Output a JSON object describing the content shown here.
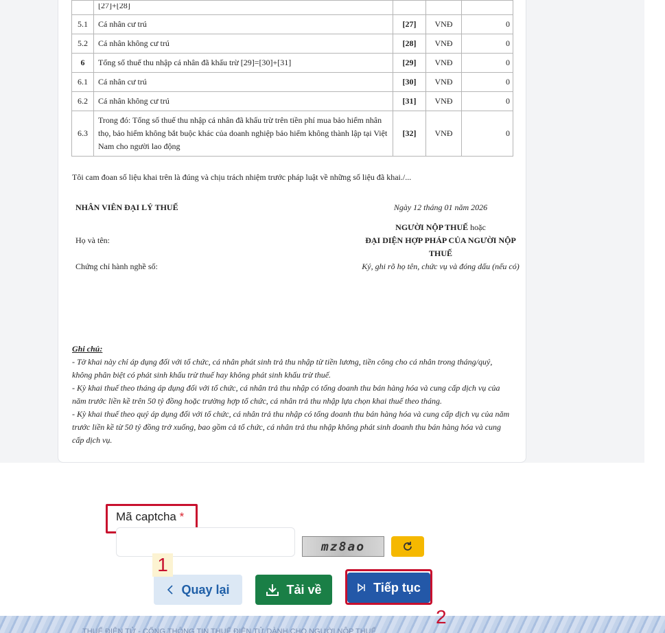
{
  "table": {
    "top_row": {
      "desc": "[27]+[28]"
    },
    "rows": [
      {
        "stt": "5.1",
        "desc": "Cá nhân cư trú",
        "code": "[27]",
        "unit": "VNĐ",
        "value": "0"
      },
      {
        "stt": "5.2",
        "desc": "Cá nhân không cư trú",
        "code": "[28]",
        "unit": "VNĐ",
        "value": "0"
      },
      {
        "stt": "6",
        "desc": "Tổng số thuế thu nhập cá nhân đã khấu trừ [29]=[30]+[31]",
        "code": "[29]",
        "unit": "VNĐ",
        "value": "0"
      },
      {
        "stt": "6.1",
        "desc": "Cá nhân cư trú",
        "code": "[30]",
        "unit": "VNĐ",
        "value": "0"
      },
      {
        "stt": "6.2",
        "desc": "Cá nhân không cư trú",
        "code": "[31]",
        "unit": "VNĐ",
        "value": "0"
      },
      {
        "stt": "6.3",
        "desc": "Trong đó: Tổng số thuế thu nhập cá nhân đã khấu trừ trên tiền phí mua bảo hiểm nhân thọ, bảo hiểm không bắt buộc khác của doanh nghiệp bảo hiểm không thành lập tại Việt Nam cho người lao động",
        "code": "[32]",
        "unit": "VNĐ",
        "value": "0"
      }
    ]
  },
  "commitment": "Tôi cam đoan số liệu khai trên là đúng và chịu trách nhiệm trước pháp luật về những số liệu đã khai./...",
  "signature": {
    "agent_title": "NHÂN VIÊN ĐẠI LÝ THUẾ",
    "name_label": "Họ và tên:",
    "cert_label": "Chứng chỉ hành nghề số:",
    "date": "Ngày 12 tháng 01 năm 2026",
    "taxpayer_line1": "NGƯỜI NỘP THUẾ",
    "taxpayer_or": "hoặc",
    "taxpayer_line2": "ĐẠI DIỆN HỢP PHÁP CỦA NGƯỜI NỘP THUẾ",
    "sign_note": "Ký, ghi rõ họ tên, chức vụ và đóng dấu (nếu có)"
  },
  "notes": {
    "title": "Ghi chú:",
    "items": [
      "- Tờ khai này chỉ áp dụng đối với tổ chức, cá nhân phát sinh trả thu nhập từ tiền lương, tiền công cho cá nhân trong tháng/quý, không phân biệt có phát sinh khấu trừ thuế hay không phát sinh khấu trừ thuế.",
      "- Kỳ khai thuế theo tháng áp dụng đối với tổ chức, cá nhân trả thu nhập có tổng doanh thu bán hàng hóa và cung cấp dịch vụ của năm trước liền kề trên 50 tỷ đồng hoặc trường hợp tổ chức, cá nhân trả thu nhập lựa chọn khai thuế theo tháng.",
      "- Kỳ khai thuế theo quý áp dụng đối với tổ chức, cá nhân trả thu nhập có tổng doanh thu bán hàng hóa và cung cấp dịch vụ của năm trước liền kề từ 50 tỷ đồng trở xuống, bao gồm cả tổ chức, cá nhân trả thu nhập không phát sinh doanh thu bán hàng hóa và cung cấp dịch vụ."
    ]
  },
  "form": {
    "captcha_label": "Mã captcha",
    "required_mark": "*",
    "captcha_value": "",
    "captcha_image_text": "mz8ao",
    "buttons": {
      "back": "Quay lại",
      "download": "Tải về",
      "next": "Tiếp tục"
    },
    "back_icon": "chevron-left-icon",
    "download_icon": "download-icon",
    "next_icon": "next-icon",
    "refresh_icon": "refresh-icon"
  },
  "annotations": {
    "first": "1",
    "second": "2"
  },
  "footer": {
    "text": "THUẾ ĐIỆN TỬ - CỔNG THÔNG TIN THUẾ ĐIỆN TỬ DÀNH CHO NGƯỜI NỘP THUẾ"
  },
  "colors": {
    "highlight_red": "#c8102e",
    "primary_blue": "#2358a8",
    "success_green": "#1a7f46",
    "warning_yellow": "#f5b800"
  }
}
